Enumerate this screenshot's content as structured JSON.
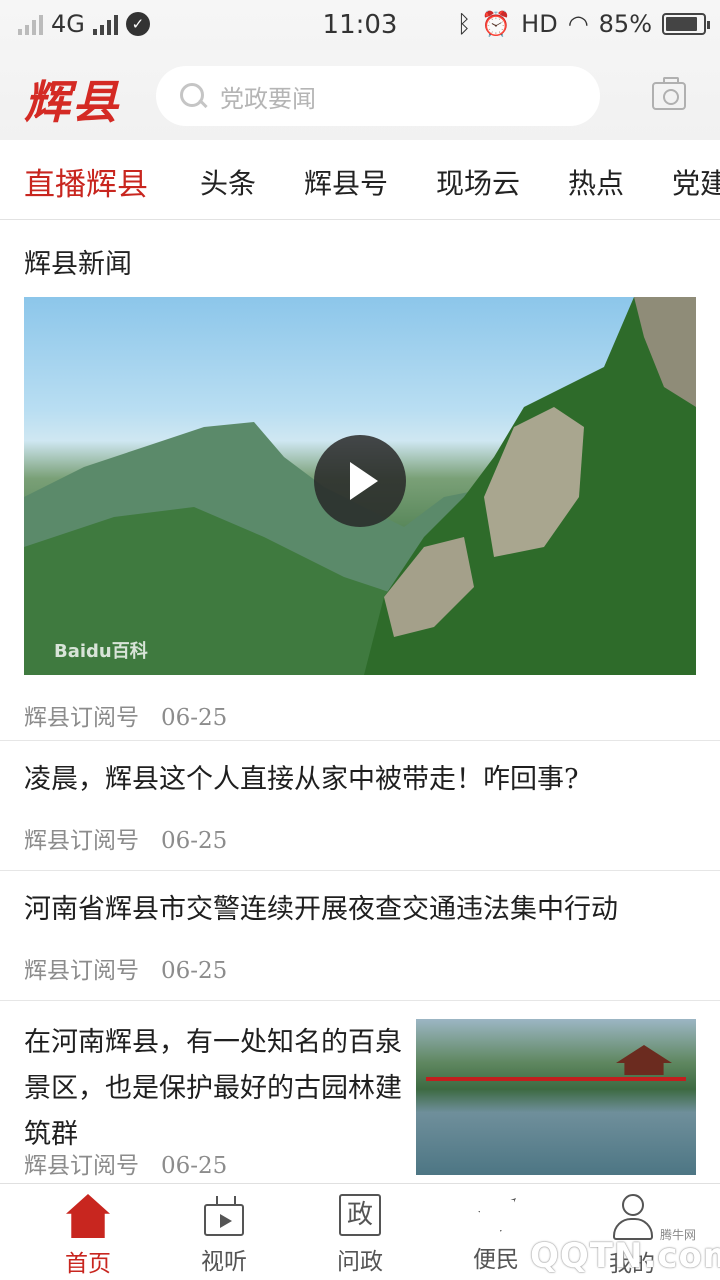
{
  "status_bar": {
    "network": "4G",
    "time": "11:03",
    "hd": "HD",
    "battery": "85%",
    "battery_level": 0.85
  },
  "header": {
    "logo": "辉县",
    "search_placeholder": "党政要闻",
    "camera_icon": "camera-icon"
  },
  "tabs": [
    {
      "label": "直播辉县",
      "active": true
    },
    {
      "label": "头条"
    },
    {
      "label": "辉县号"
    },
    {
      "label": "现场云"
    },
    {
      "label": "热点"
    },
    {
      "label": "党建"
    }
  ],
  "feed": {
    "section_title": "辉县新闻",
    "video": {
      "source": "辉县订阅号",
      "date": "06-25",
      "watermark": "Baidu百科"
    },
    "articles": [
      {
        "title": "凌晨，辉县这个人直接从家中被带走！咋回事?",
        "source": "辉县订阅号",
        "date": "06-25"
      },
      {
        "title": "河南省辉县市交警连续开展夜查交通违法集中行动",
        "source": "辉县订阅号",
        "date": "06-25"
      },
      {
        "title": "在河南辉县，有一处知名的百泉景区，也是保护最好的古园林建筑群",
        "source": "辉县订阅号",
        "date": "06-25"
      }
    ]
  },
  "bottom_nav": [
    {
      "label": "首页",
      "icon": "home-icon",
      "active": true
    },
    {
      "label": "视听",
      "icon": "tv-icon"
    },
    {
      "label": "问政",
      "icon": "zheng-icon",
      "glyph": "政"
    },
    {
      "label": "便民",
      "icon": "send-icon"
    },
    {
      "label": "我的",
      "icon": "user-icon"
    }
  ],
  "watermark": {
    "text": "QQTN.com",
    "small": "腾牛网"
  },
  "colors": {
    "accent": "#c8261f",
    "logo": "#d42a24"
  }
}
